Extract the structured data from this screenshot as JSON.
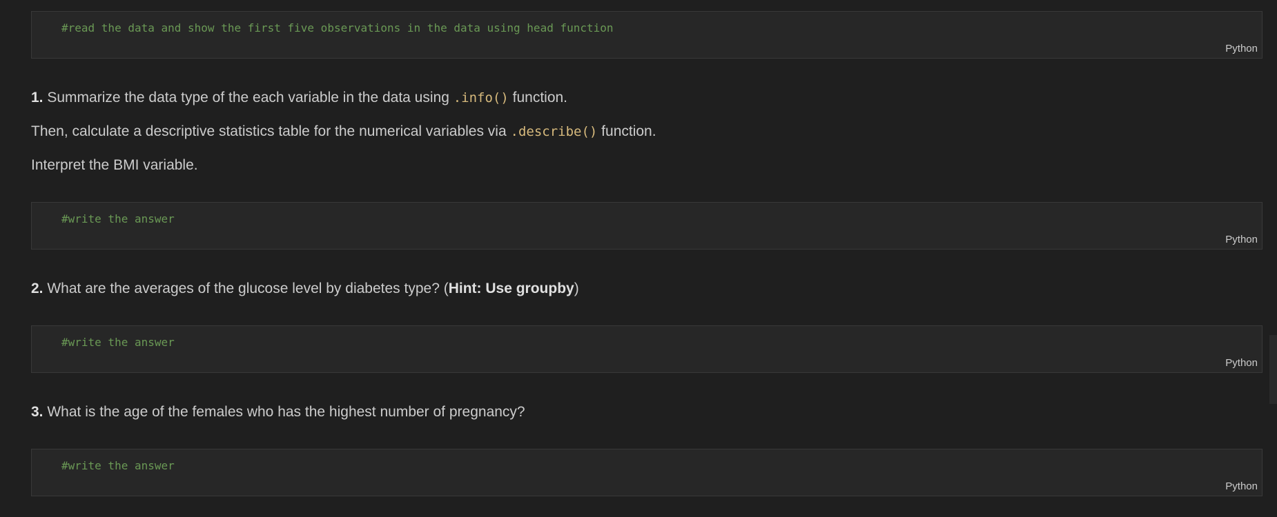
{
  "cells": {
    "cell1": {
      "code": "#read the data and show the first five observations in the data using head function",
      "language": "Python"
    },
    "cell2": {
      "code": "#write the answer",
      "language": "Python"
    },
    "cell3": {
      "code": "#write the answer",
      "language": "Python"
    },
    "cell4": {
      "code": "#write the answer",
      "language": "Python"
    }
  },
  "markdown": {
    "q1": {
      "number": "1.",
      "line1_text": " Summarize the data type of the each variable in the data using ",
      "line1_code": ".info()",
      "line1_end": " function.",
      "line2_text": "Then, calculate a descriptive statistics table for the numerical variables via ",
      "line2_code": ".describe()",
      "line2_end": " function.",
      "line3_text": "Interpret the BMI variable."
    },
    "q2": {
      "number": "2.",
      "text": " What are the averages of the glucose level by diabetes type? (",
      "hint": "Hint: Use groupby",
      "end": ")"
    },
    "q3": {
      "number": "3.",
      "text": " What is the age of the females who has the highest number of pregnancy?"
    }
  }
}
